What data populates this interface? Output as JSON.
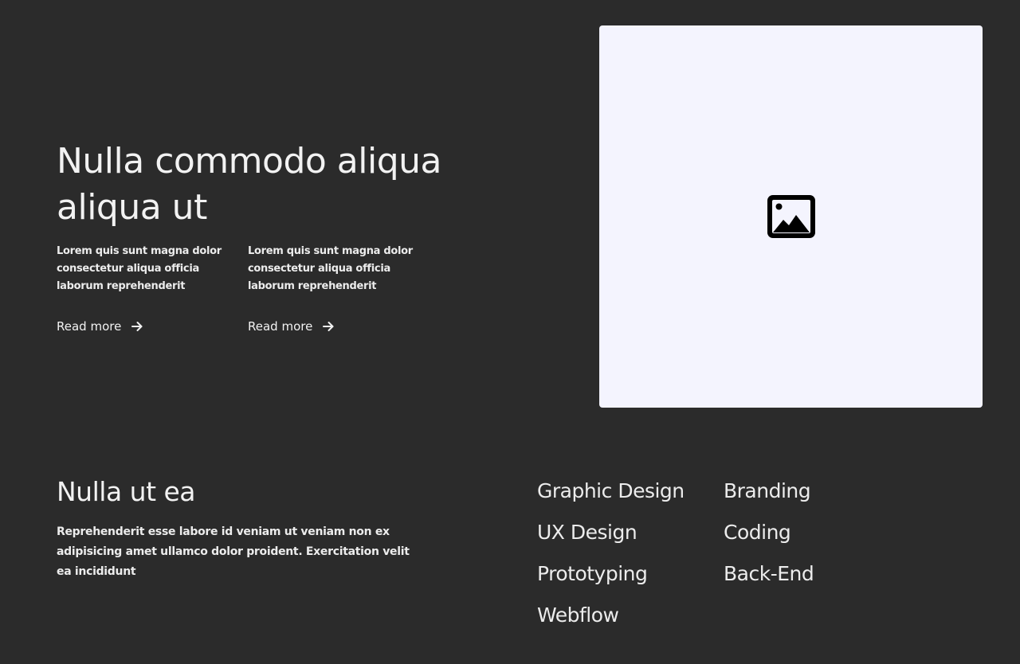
{
  "hero": {
    "title": "Nulla commodo aliqua aliqua ut",
    "features": [
      {
        "text": "Lorem quis sunt magna dolor consectetur aliqua officia laborum reprehenderit",
        "link_label": "Read more",
        "link_icon": "arrow-right-icon"
      },
      {
        "text": "Lorem quis sunt magna dolor consectetur aliqua officia laborum reprehenderit",
        "link_label": "Read more",
        "link_icon": "arrow-right-icon"
      }
    ],
    "image": {
      "icon": "image-placeholder-icon",
      "background": "#f4f4fe"
    }
  },
  "about": {
    "title": "Nulla ut ea",
    "text": "Reprehenderit esse labore id veniam ut veniam non ex adipisicing amet ullamco dolor proident. Exercitation velit ea incididunt"
  },
  "skills": {
    "column_1": [
      "Graphic Design",
      "UX Design",
      "Prototyping",
      "Webflow"
    ],
    "column_2": [
      "Branding",
      "Coding",
      "Back-End"
    ]
  },
  "colors": {
    "background": "#2b2b2b",
    "text": "#f2f2f2",
    "placeholder": "#f4f4fe"
  }
}
